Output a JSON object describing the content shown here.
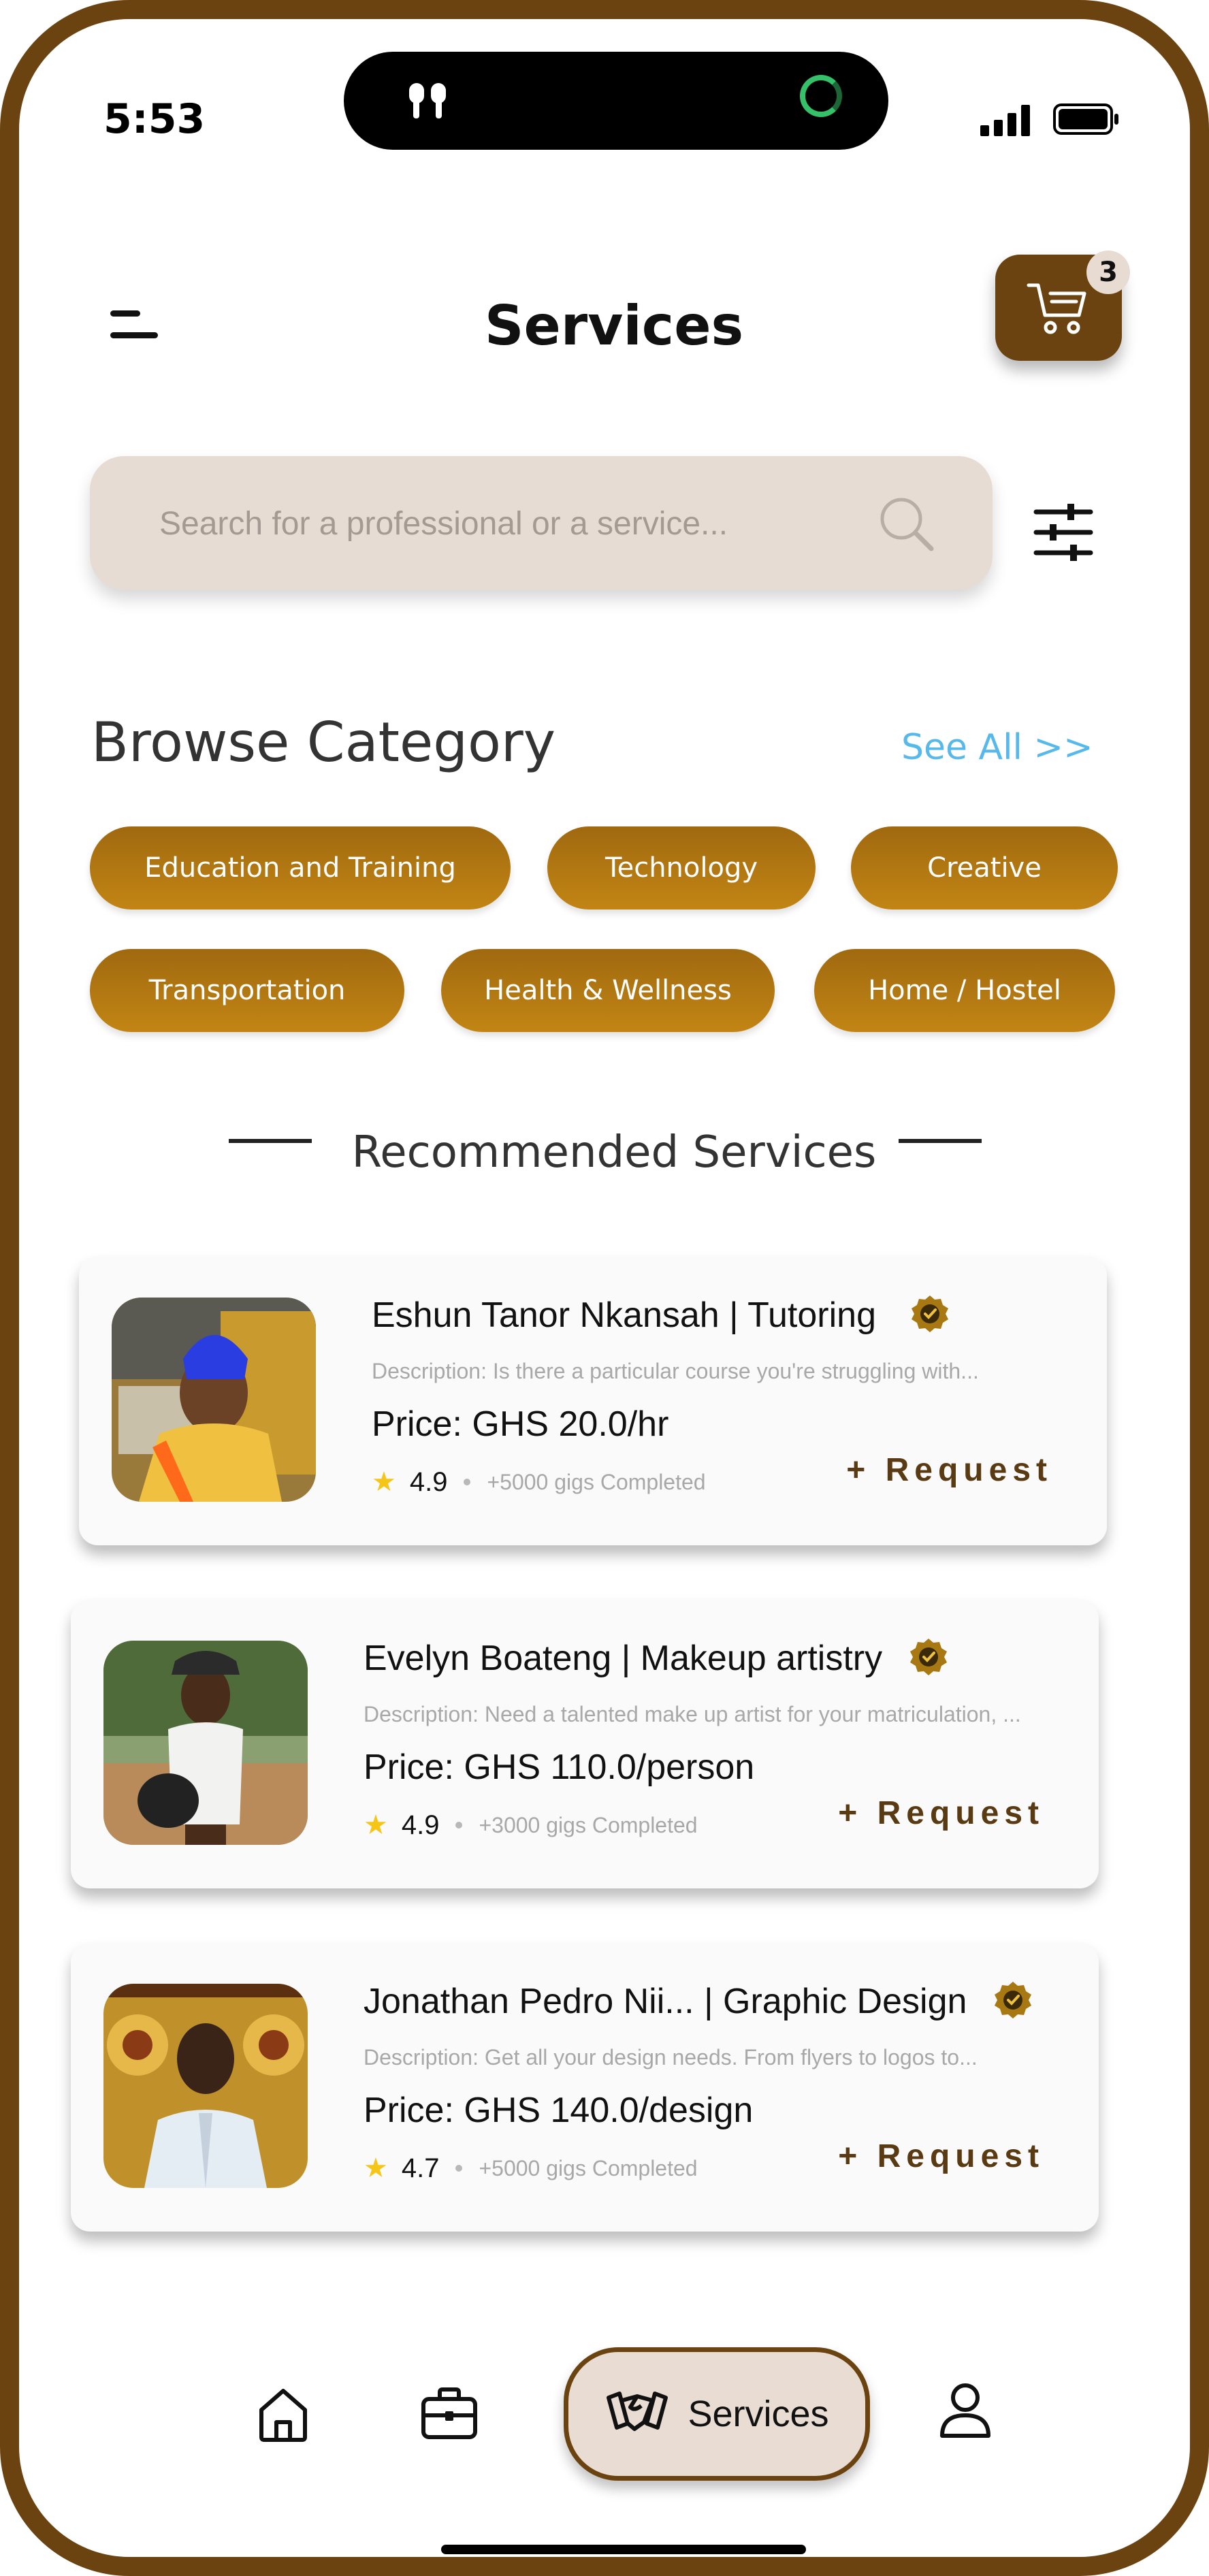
{
  "status_bar": {
    "time": "5:53"
  },
  "header": {
    "title": "Services",
    "cart_count": "3"
  },
  "search": {
    "placeholder": "Search for a professional or a service..."
  },
  "browse": {
    "title": "Browse Category",
    "see_all": "See All >>",
    "categories": [
      "Education and Training",
      "Technology",
      "Creative",
      "Transportation",
      "Health & Wellness",
      "Home / Hostel"
    ]
  },
  "recommended": {
    "title": "Recommended Services",
    "cards": [
      {
        "name": "Eshun Tanor Nkansah | Tutoring",
        "description": "Description: Is there a particular course you're struggling with...",
        "price": "Price: GHS 20.0/hr",
        "rating": "4.9",
        "gigs": "+5000 gigs Completed",
        "request": "+ Request"
      },
      {
        "name": "Evelyn Boateng | Makeup artistry",
        "description": "Description: Need a talented make up artist for your matriculation, ...",
        "price": "Price: GHS 110.0/person",
        "rating": "4.9",
        "gigs": "+3000 gigs Completed",
        "request": "+ Request"
      },
      {
        "name": "Jonathan Pedro Nii... | Graphic Design",
        "description": "Description: Get all your design needs. From flyers to logos to...",
        "price": "Price: GHS 140.0/design",
        "rating": "4.7",
        "gigs": "+5000 gigs Completed",
        "request": "+ Request"
      }
    ]
  },
  "bottom_nav": {
    "items": [
      "home-icon",
      "briefcase-icon",
      "handshake-icon",
      "user-icon"
    ],
    "active_label": "Services"
  },
  "colors": {
    "brand": "#6b4310",
    "chip": "#b07812",
    "accent_link": "#57b8ec",
    "search_bg": "#e6dcd3",
    "star": "#f5c518"
  }
}
